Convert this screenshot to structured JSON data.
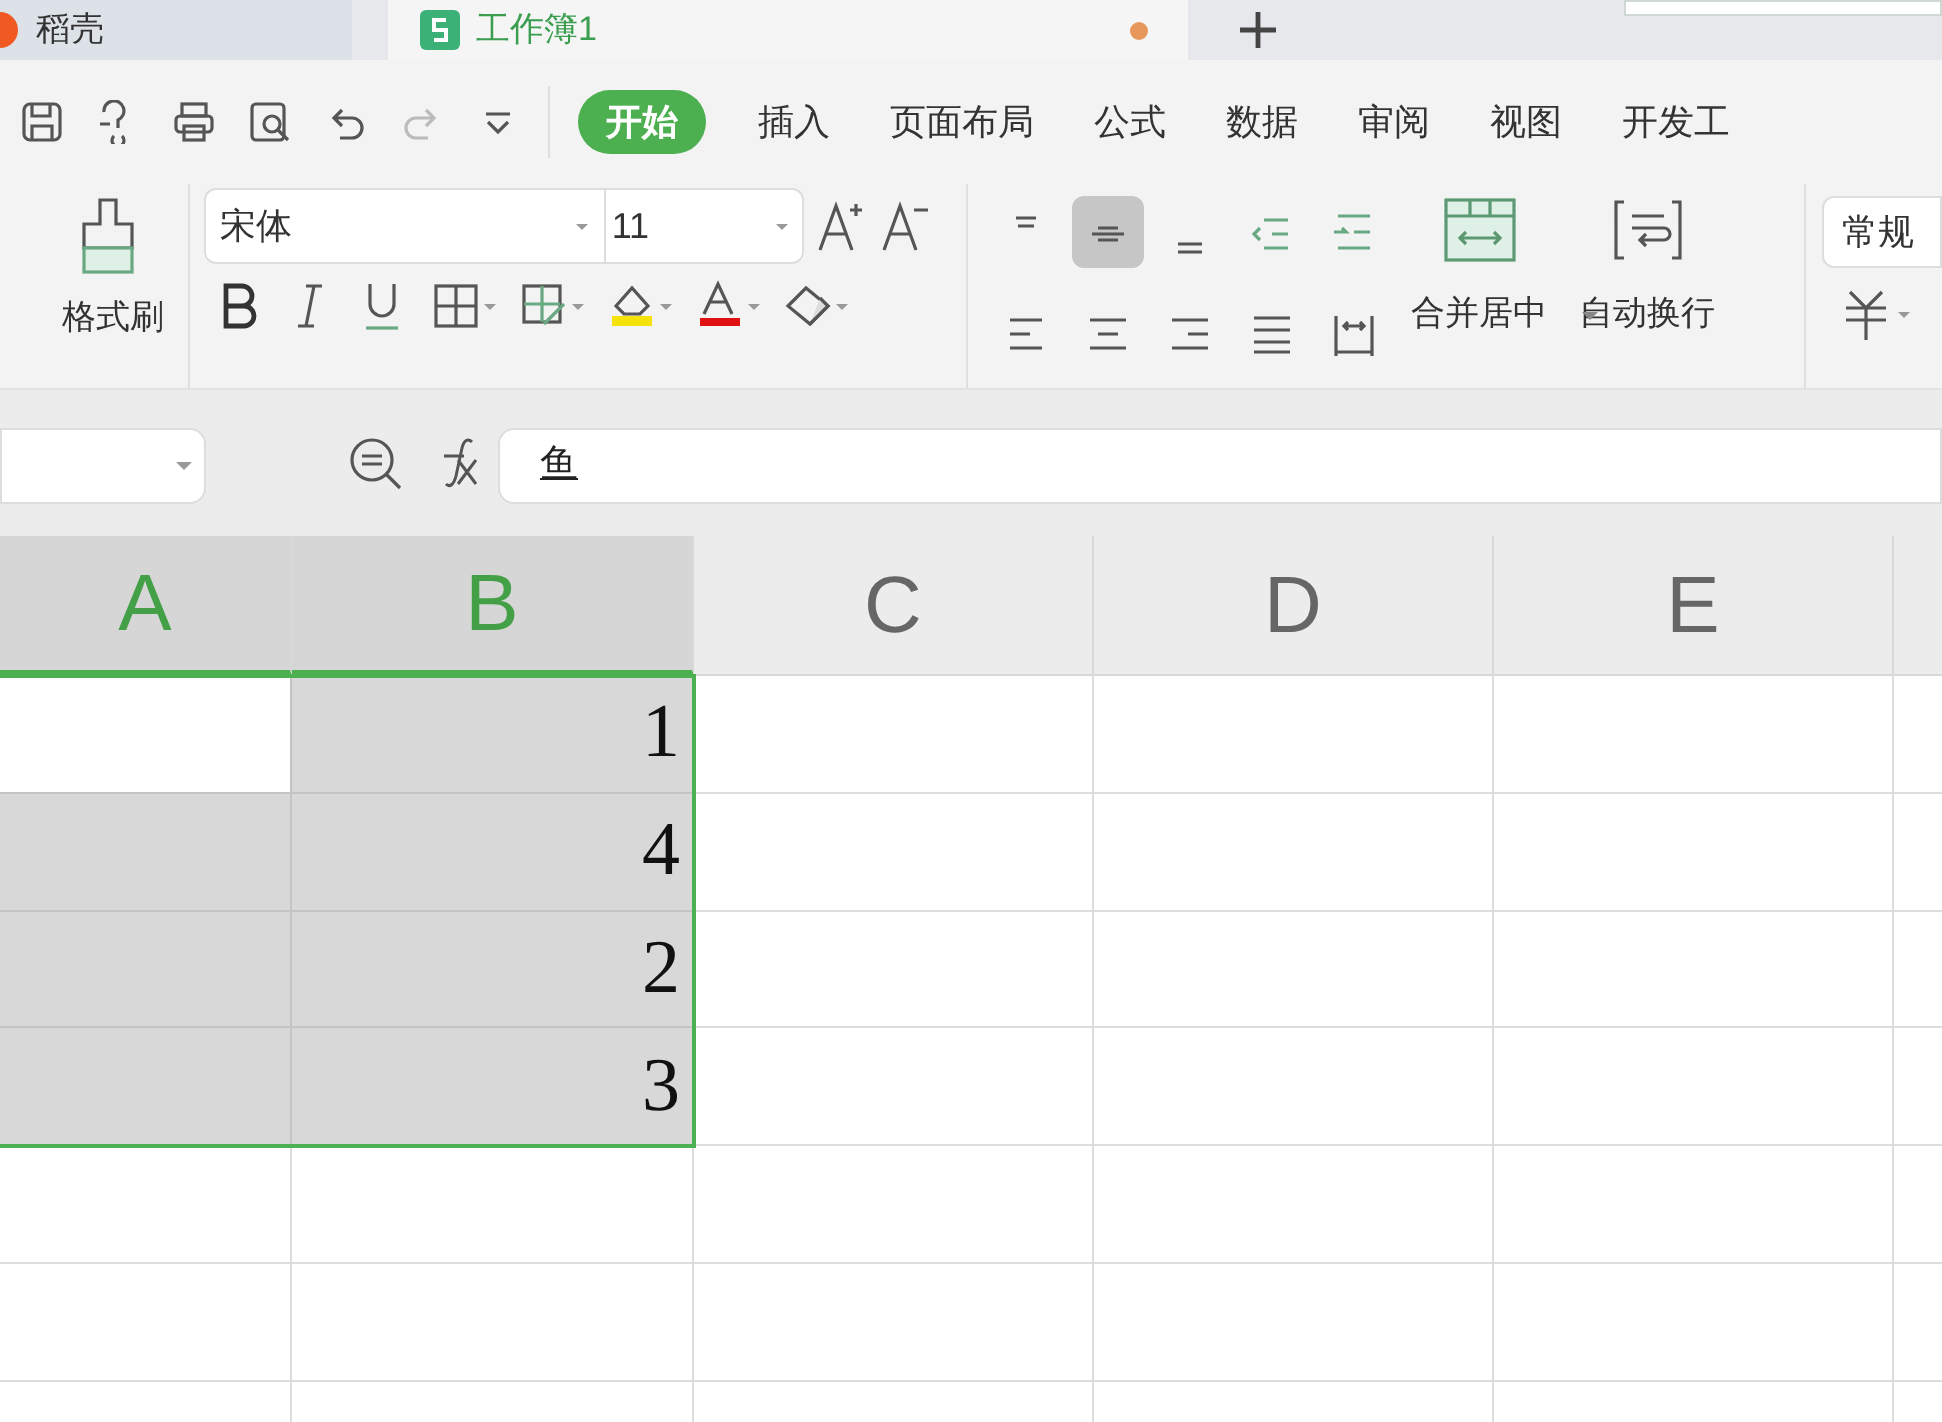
{
  "tabs": [
    {
      "label": "稻壳",
      "kind": "docer",
      "selected": false,
      "unsaved": false
    },
    {
      "label": "工作簿1",
      "kind": "sheet",
      "selected": true,
      "unsaved": true
    }
  ],
  "menu": [
    {
      "label": "开始",
      "selected": true
    },
    {
      "label": "插入",
      "selected": false
    },
    {
      "label": "页面布局",
      "selected": false
    },
    {
      "label": "公式",
      "selected": false
    },
    {
      "label": "数据",
      "selected": false
    },
    {
      "label": "审阅",
      "selected": false
    },
    {
      "label": "视图",
      "selected": false
    },
    {
      "label": "开发工",
      "selected": false
    }
  ],
  "ribbon": {
    "format_painter": "格式刷",
    "font_name": "宋体",
    "font_size": "11",
    "merge_label": "合并居中",
    "wrap_label": "自动换行",
    "number_format": "常规",
    "align_buttons": [
      {
        "kind": "top",
        "selected": false
      },
      {
        "kind": "middle",
        "selected": true
      },
      {
        "kind": "bottom",
        "selected": false
      },
      {
        "kind": "outdent",
        "selected": false
      },
      {
        "kind": "indent",
        "selected": false
      }
    ]
  },
  "formula_bar": {
    "content": "鱼"
  },
  "grid": {
    "columns": [
      {
        "label": "A",
        "selected": true
      },
      {
        "label": "B",
        "selected": true
      },
      {
        "label": "C",
        "selected": false
      },
      {
        "label": "D",
        "selected": false
      },
      {
        "label": "E",
        "selected": false
      }
    ],
    "rows": [
      {
        "cells": [
          {
            "selected": true
          },
          {
            "value": "1",
            "selected": true
          },
          {
            "selected": false
          },
          {
            "selected": false
          },
          {
            "selected": false
          }
        ]
      },
      {
        "cells": [
          {
            "selected": true
          },
          {
            "value": "4",
            "selected": true
          },
          {
            "selected": false
          },
          {
            "selected": false
          },
          {
            "selected": false
          }
        ]
      },
      {
        "cells": [
          {
            "selected": true
          },
          {
            "value": "2",
            "selected": true
          },
          {
            "selected": false
          },
          {
            "selected": false
          },
          {
            "selected": false
          }
        ]
      },
      {
        "cells": [
          {
            "selected": true
          },
          {
            "value": "3",
            "selected": true
          },
          {
            "selected": false
          },
          {
            "selected": false
          },
          {
            "selected": false
          }
        ]
      },
      {
        "cells": [
          {
            "selected": false
          },
          {
            "selected": false
          },
          {
            "selected": false
          },
          {
            "selected": false
          },
          {
            "selected": false
          }
        ]
      },
      {
        "cells": [
          {
            "selected": false
          },
          {
            "selected": false
          },
          {
            "selected": false
          },
          {
            "selected": false
          },
          {
            "selected": false
          }
        ]
      },
      {
        "cells": [
          {
            "selected": false
          },
          {
            "selected": false
          },
          {
            "selected": false
          },
          {
            "selected": false
          },
          {
            "selected": false
          }
        ]
      }
    ]
  }
}
